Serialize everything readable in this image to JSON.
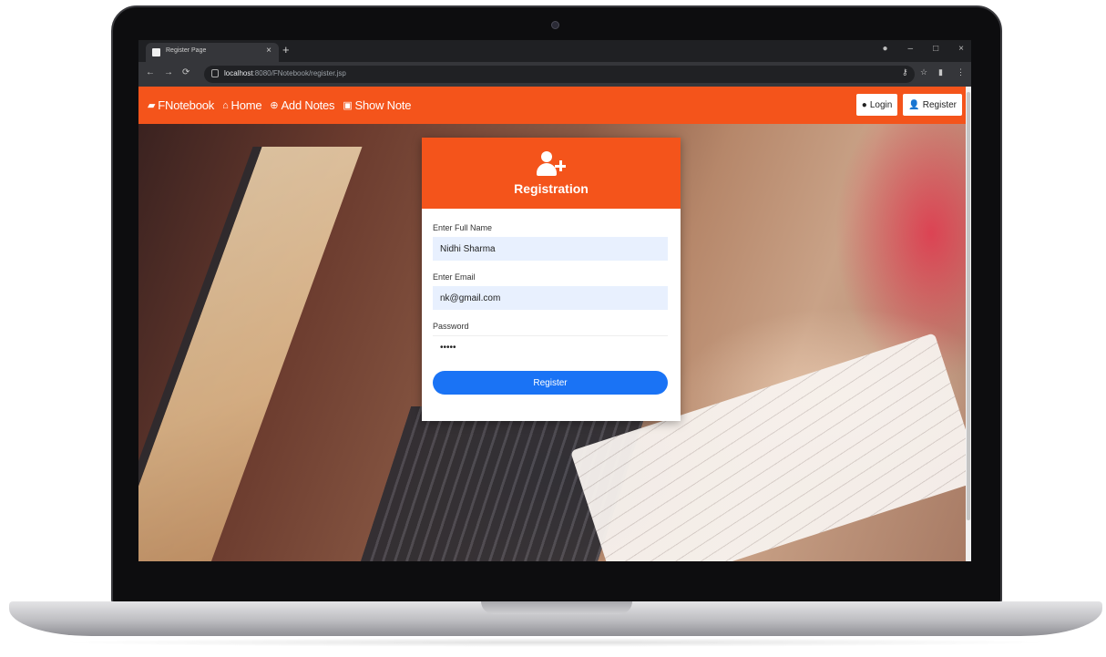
{
  "browser": {
    "tab_title": "Register Page",
    "tab_close": "×",
    "new_tab": "+",
    "url_host": "localhost",
    "url_path": ":8080/FNotebook/register.jsp",
    "controls": {
      "minimize": "–",
      "maximize": "□",
      "close": "×"
    }
  },
  "navbar": {
    "brand": "FNotebook",
    "links": [
      {
        "label": "Home",
        "icon": "home-icon"
      },
      {
        "label": "Add Notes",
        "icon": "plus-circle-icon"
      },
      {
        "label": "Show Note",
        "icon": "address-book-icon"
      }
    ],
    "login_label": "Login",
    "register_label": "Register"
  },
  "card": {
    "title": "Registration",
    "name_label": "Enter Full Name",
    "name_value": "Nidhi Sharma",
    "email_label": "Enter Email",
    "email_value": "nk@gmail.com",
    "password_label": "Password",
    "password_value": "•••••",
    "submit_label": "Register"
  },
  "colors": {
    "brand_orange": "#f4541b",
    "button_blue": "#1a73f5",
    "autofill_bg": "#e8f0fe"
  }
}
